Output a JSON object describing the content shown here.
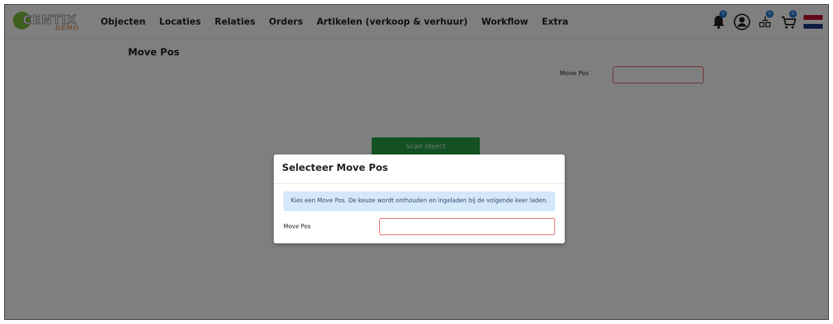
{
  "logo": {
    "text": "CENTIX",
    "badge": "DEMO"
  },
  "nav": {
    "items": [
      "Objecten",
      "Locaties",
      "Relaties",
      "Orders",
      "Artikelen (verkoop & verhuur)",
      "Workflow",
      "Extra"
    ]
  },
  "header_icons": [
    {
      "icon": "bell-icon",
      "badge": "5"
    },
    {
      "icon": "user-icon"
    },
    {
      "icon": "scanner-icon",
      "badge": "0"
    },
    {
      "icon": "cart-icon",
      "badge": "0"
    },
    {
      "icon": "dutch-flag-icon"
    }
  ],
  "page": {
    "title": "Move Pos",
    "field_label": "Move Pos",
    "field_value": "",
    "scan_button": "Scan object"
  },
  "modal": {
    "title": "Selecteer Move Pos",
    "info": "Kies een Move Pos. De keuze wordt onthouden en ingeladen bij de volgende keer laden.",
    "field_label": "Move Pos",
    "field_value": ""
  },
  "colors": {
    "primary_button": "#26a244",
    "input_border_error": "#e05a5a",
    "badge": "#1e7ad6",
    "info_bg": "#d4e7fb",
    "overlay": "rgba(0,0,0,0.5)"
  }
}
